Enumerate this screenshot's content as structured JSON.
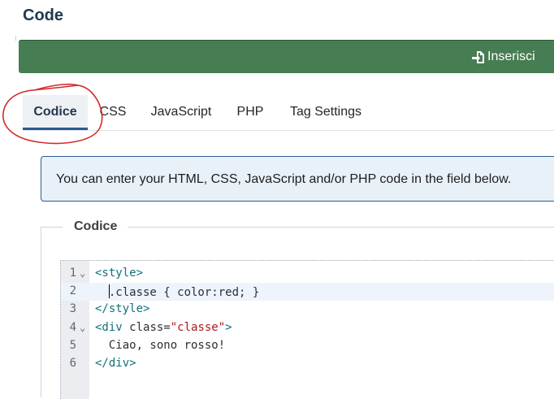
{
  "page": {
    "title": "Code"
  },
  "toolbar": {
    "insert_label": "Inserisci",
    "color": "#477d52"
  },
  "tabs": [
    {
      "label": "Codice",
      "active": true
    },
    {
      "label": "CSS",
      "active": false
    },
    {
      "label": "JavaScript",
      "active": false
    },
    {
      "label": "PHP",
      "active": false
    },
    {
      "label": "Tag Settings",
      "active": false
    }
  ],
  "alert": {
    "text": "You can enter your HTML, CSS, JavaScript and/or PHP code in the field below."
  },
  "fieldset": {
    "legend": "Codice"
  },
  "editor": {
    "lines": [
      {
        "num": "1",
        "foldable": true
      },
      {
        "num": "2",
        "foldable": false
      },
      {
        "num": "3",
        "foldable": false
      },
      {
        "num": "4",
        "foldable": true
      },
      {
        "num": "5",
        "foldable": false
      },
      {
        "num": "6",
        "foldable": false
      }
    ],
    "current_line": 2,
    "code": {
      "l1_tag": "<style>",
      "l2_text": ".classe { color:red; }",
      "l3_tag": "</style>",
      "l4_open": "<div ",
      "l4_attr": "class=",
      "l4_str": "\"classe\"",
      "l4_close": ">",
      "l5_text": "Ciao, sono rosso!",
      "l6_tag": "</div>"
    }
  },
  "annotation_color": "#d42a2a"
}
